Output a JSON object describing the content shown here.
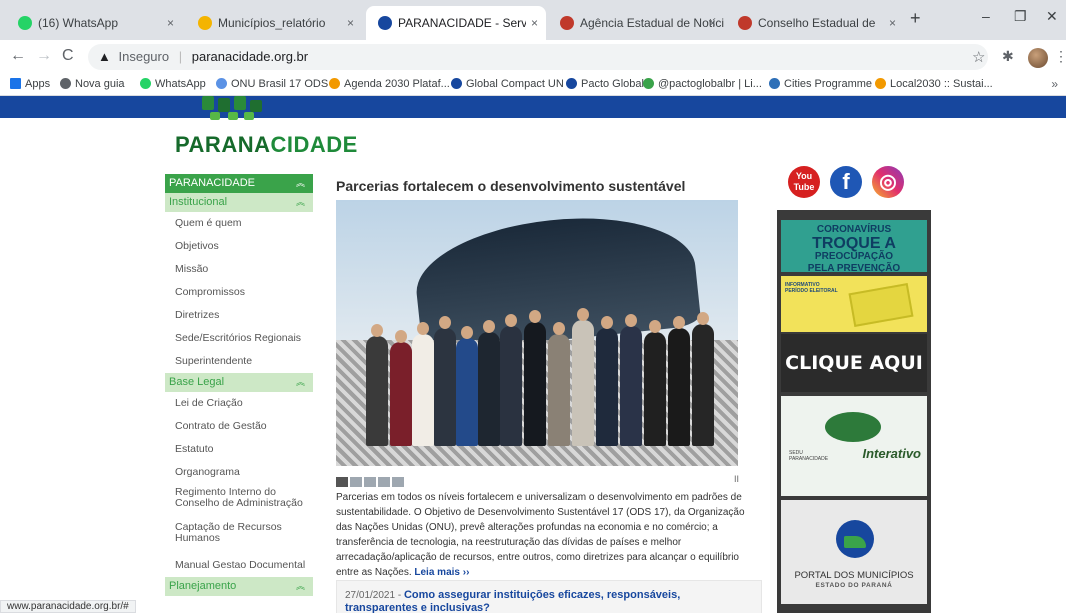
{
  "browser": {
    "tabs": [
      {
        "title": "(16) WhatsApp",
        "color": "#25d366",
        "active": false
      },
      {
        "title": "Municípios_relatório",
        "color": "#f4b400",
        "active": false
      },
      {
        "title": "PARANACIDADE - Serviço Soci",
        "color": "#17479e",
        "active": true
      },
      {
        "title": "Agência Estadual de Notícias",
        "color": "#c0392b",
        "active": false
      },
      {
        "title": "Conselho Estadual de Desenvo",
        "color": "#c0392b",
        "active": false
      }
    ],
    "close_glyph": "×",
    "new_tab": "+",
    "window_controls": [
      "–",
      "❐",
      "✕"
    ],
    "back": "←",
    "forward": "→",
    "reload": "C",
    "security_label": "Inseguro",
    "url": "paranacidade.org.br",
    "bookmarks": [
      {
        "label": "Apps",
        "color": "#1a73e8"
      },
      {
        "label": "Nova guia",
        "color": "#5f6368"
      },
      {
        "label": "WhatsApp",
        "color": "#25d366"
      },
      {
        "label": "ONU Brasil 17 ODS",
        "color": "#5b92e5"
      },
      {
        "label": "Agenda 2030 Plataf...",
        "color": "#f29900"
      },
      {
        "label": "Global Compact UN",
        "color": "#17479e"
      },
      {
        "label": "Pacto Global",
        "color": "#17479e"
      },
      {
        "label": "@pactoglobalbr | Li...",
        "color": "#3aa34a"
      },
      {
        "label": "Cities Programme",
        "color": "#2e6fb7"
      },
      {
        "label": "Local2030 :: Sustai...",
        "color": "#f29900"
      }
    ],
    "bookmarks_more": "»",
    "status_url": "www.paranacidade.org.br/#"
  },
  "site": {
    "logo_text_a": "PARANA",
    "logo_text_b": "CIDADE",
    "sidebar": {
      "header": "PARANACIDADE",
      "sections": [
        {
          "title": "Institucional",
          "items": [
            "Quem é quem",
            "Objetivos",
            "Missão",
            "Compromissos",
            "Diretrizes",
            "Sede/Escritórios Regionais",
            "Superintendente"
          ]
        },
        {
          "title": "Base Legal",
          "items": [
            "Lei de Criação",
            "Contrato de Gestão",
            "Estatuto",
            "Organograma",
            "Regimento Interno do Conselho de Administração",
            "Captação de Recursos Humanos",
            "Manual Gestao Documental"
          ]
        },
        {
          "title": "Planejamento",
          "items": []
        }
      ]
    },
    "main": {
      "title": "Parcerias fortalecem o desenvolvimento sustentável",
      "body": "Parcerias em todos os níveis fortalecem e universalizam o desenvolvimento em padrões de sustentabilidade. O Objetivo de Desenvolvimento Sustentável 17 (ODS 17), da Organização das Nações Unidas (ONU), prevê alterações profundas na economia e no comércio; a transferência de tecnologia, na reestruturação das dívidas de países e melhor arrecadação/aplicação de recursos, entre outros, como diretrizes para alcançar o equilíbrio entre as Nações.",
      "read_more": "Leia mais ››",
      "pause_glyph": "II",
      "news": {
        "date": "27/01/2021 - ",
        "title": "Como assegurar instituições eficazes, responsáveis, transparentes e inclusivas?"
      }
    },
    "social": {
      "youtube_a": "You",
      "youtube_b": "Tube",
      "facebook": "f",
      "instagram": "◎"
    },
    "banners": {
      "corona_l1": "CORONAVÍRUS",
      "corona_l2": "TROQUE A",
      "corona_l3": "PREOCUPAÇÃO",
      "corona_l4": "PELA PREVENÇÃO",
      "eleitoral_tag": "INFORMATIVO",
      "eleitoral_sub": "PERÍODO ELEITORAL",
      "clique": "CLIQUE AQUI",
      "interativo_small_a": "SEDU",
      "interativo_small_b": "PARANACIDADE",
      "interativo": "Interativo",
      "portal_l1": "PORTAL DOS MUNICÍPIOS",
      "portal_l2": "ESTADO DO PARANÁ"
    }
  }
}
